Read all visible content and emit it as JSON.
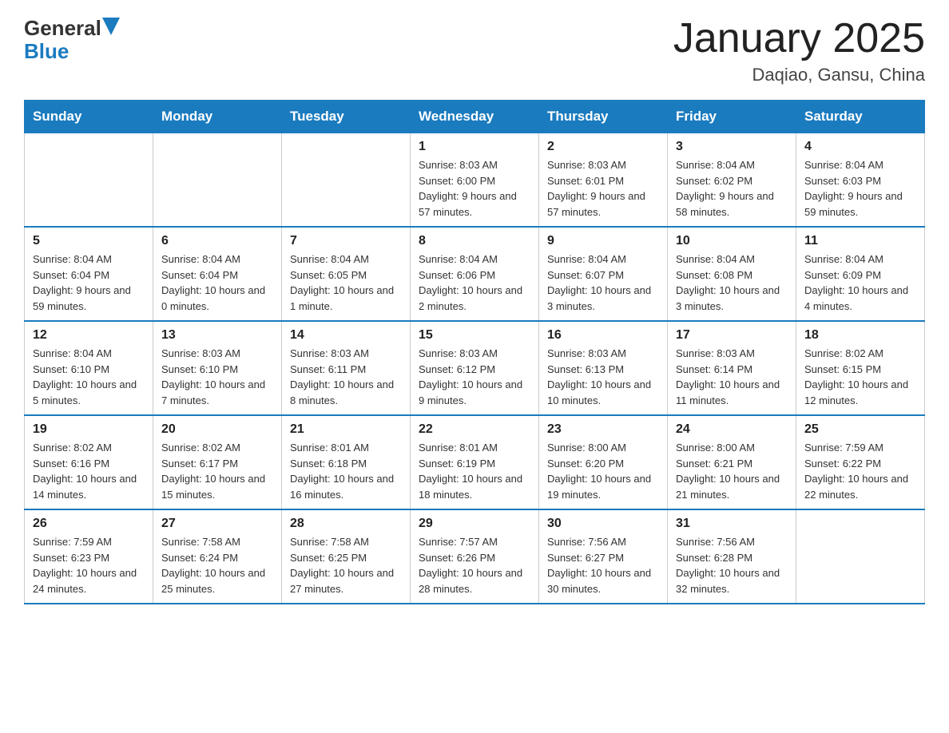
{
  "header": {
    "logo_general": "General",
    "logo_blue": "Blue",
    "month_year": "January 2025",
    "location": "Daqiao, Gansu, China"
  },
  "days_of_week": [
    "Sunday",
    "Monday",
    "Tuesday",
    "Wednesday",
    "Thursday",
    "Friday",
    "Saturday"
  ],
  "weeks": [
    [
      {
        "day": "",
        "info": ""
      },
      {
        "day": "",
        "info": ""
      },
      {
        "day": "",
        "info": ""
      },
      {
        "day": "1",
        "info": "Sunrise: 8:03 AM\nSunset: 6:00 PM\nDaylight: 9 hours\nand 57 minutes."
      },
      {
        "day": "2",
        "info": "Sunrise: 8:03 AM\nSunset: 6:01 PM\nDaylight: 9 hours\nand 57 minutes."
      },
      {
        "day": "3",
        "info": "Sunrise: 8:04 AM\nSunset: 6:02 PM\nDaylight: 9 hours\nand 58 minutes."
      },
      {
        "day": "4",
        "info": "Sunrise: 8:04 AM\nSunset: 6:03 PM\nDaylight: 9 hours\nand 59 minutes."
      }
    ],
    [
      {
        "day": "5",
        "info": "Sunrise: 8:04 AM\nSunset: 6:04 PM\nDaylight: 9 hours\nand 59 minutes."
      },
      {
        "day": "6",
        "info": "Sunrise: 8:04 AM\nSunset: 6:04 PM\nDaylight: 10 hours\nand 0 minutes."
      },
      {
        "day": "7",
        "info": "Sunrise: 8:04 AM\nSunset: 6:05 PM\nDaylight: 10 hours\nand 1 minute."
      },
      {
        "day": "8",
        "info": "Sunrise: 8:04 AM\nSunset: 6:06 PM\nDaylight: 10 hours\nand 2 minutes."
      },
      {
        "day": "9",
        "info": "Sunrise: 8:04 AM\nSunset: 6:07 PM\nDaylight: 10 hours\nand 3 minutes."
      },
      {
        "day": "10",
        "info": "Sunrise: 8:04 AM\nSunset: 6:08 PM\nDaylight: 10 hours\nand 3 minutes."
      },
      {
        "day": "11",
        "info": "Sunrise: 8:04 AM\nSunset: 6:09 PM\nDaylight: 10 hours\nand 4 minutes."
      }
    ],
    [
      {
        "day": "12",
        "info": "Sunrise: 8:04 AM\nSunset: 6:10 PM\nDaylight: 10 hours\nand 5 minutes."
      },
      {
        "day": "13",
        "info": "Sunrise: 8:03 AM\nSunset: 6:10 PM\nDaylight: 10 hours\nand 7 minutes."
      },
      {
        "day": "14",
        "info": "Sunrise: 8:03 AM\nSunset: 6:11 PM\nDaylight: 10 hours\nand 8 minutes."
      },
      {
        "day": "15",
        "info": "Sunrise: 8:03 AM\nSunset: 6:12 PM\nDaylight: 10 hours\nand 9 minutes."
      },
      {
        "day": "16",
        "info": "Sunrise: 8:03 AM\nSunset: 6:13 PM\nDaylight: 10 hours\nand 10 minutes."
      },
      {
        "day": "17",
        "info": "Sunrise: 8:03 AM\nSunset: 6:14 PM\nDaylight: 10 hours\nand 11 minutes."
      },
      {
        "day": "18",
        "info": "Sunrise: 8:02 AM\nSunset: 6:15 PM\nDaylight: 10 hours\nand 12 minutes."
      }
    ],
    [
      {
        "day": "19",
        "info": "Sunrise: 8:02 AM\nSunset: 6:16 PM\nDaylight: 10 hours\nand 14 minutes."
      },
      {
        "day": "20",
        "info": "Sunrise: 8:02 AM\nSunset: 6:17 PM\nDaylight: 10 hours\nand 15 minutes."
      },
      {
        "day": "21",
        "info": "Sunrise: 8:01 AM\nSunset: 6:18 PM\nDaylight: 10 hours\nand 16 minutes."
      },
      {
        "day": "22",
        "info": "Sunrise: 8:01 AM\nSunset: 6:19 PM\nDaylight: 10 hours\nand 18 minutes."
      },
      {
        "day": "23",
        "info": "Sunrise: 8:00 AM\nSunset: 6:20 PM\nDaylight: 10 hours\nand 19 minutes."
      },
      {
        "day": "24",
        "info": "Sunrise: 8:00 AM\nSunset: 6:21 PM\nDaylight: 10 hours\nand 21 minutes."
      },
      {
        "day": "25",
        "info": "Sunrise: 7:59 AM\nSunset: 6:22 PM\nDaylight: 10 hours\nand 22 minutes."
      }
    ],
    [
      {
        "day": "26",
        "info": "Sunrise: 7:59 AM\nSunset: 6:23 PM\nDaylight: 10 hours\nand 24 minutes."
      },
      {
        "day": "27",
        "info": "Sunrise: 7:58 AM\nSunset: 6:24 PM\nDaylight: 10 hours\nand 25 minutes."
      },
      {
        "day": "28",
        "info": "Sunrise: 7:58 AM\nSunset: 6:25 PM\nDaylight: 10 hours\nand 27 minutes."
      },
      {
        "day": "29",
        "info": "Sunrise: 7:57 AM\nSunset: 6:26 PM\nDaylight: 10 hours\nand 28 minutes."
      },
      {
        "day": "30",
        "info": "Sunrise: 7:56 AM\nSunset: 6:27 PM\nDaylight: 10 hours\nand 30 minutes."
      },
      {
        "day": "31",
        "info": "Sunrise: 7:56 AM\nSunset: 6:28 PM\nDaylight: 10 hours\nand 32 minutes."
      },
      {
        "day": "",
        "info": ""
      }
    ]
  ]
}
